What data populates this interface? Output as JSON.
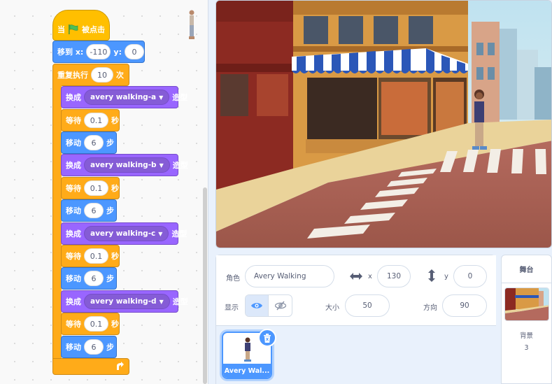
{
  "code": {
    "hat": {
      "when_label": "当",
      "flag_icon": "green-flag-icon",
      "clicked_label": "被点击"
    },
    "goto": {
      "label": "移到 x:",
      "x": "-110",
      "y_label": "y:",
      "y": "0"
    },
    "repeat": {
      "label": "重复执行",
      "times": "10",
      "suffix": "次",
      "loop_icon": "loop-arrow-icon"
    },
    "switch_label": "换成",
    "costume_suffix": "造型",
    "wait_label": "等待",
    "wait_value": "0.1",
    "wait_unit": "秒",
    "move_label": "移动",
    "move_value": "6",
    "move_unit": "步",
    "costumes": [
      "avery walking-a",
      "avery walking-b",
      "avery walking-c",
      "avery walking-d"
    ]
  },
  "sprite_info": {
    "sprite_label": "角色",
    "sprite_name": "Avery Walking",
    "x_label": "x",
    "x_value": "130",
    "y_label": "y",
    "y_value": "0",
    "show_label": "显示",
    "size_label": "大小",
    "size_value": "50",
    "direction_label": "方向",
    "direction_value": "90"
  },
  "sprite_tray": {
    "tile_name": "Avery Wal..."
  },
  "stage_panel": {
    "header": "舞台",
    "backdrops_label": "背景",
    "backdrop_count": "3"
  },
  "colors": {
    "events": "#ffbf00",
    "motion": "#4c97ff",
    "control": "#ffab19",
    "looks": "#9966ff"
  }
}
